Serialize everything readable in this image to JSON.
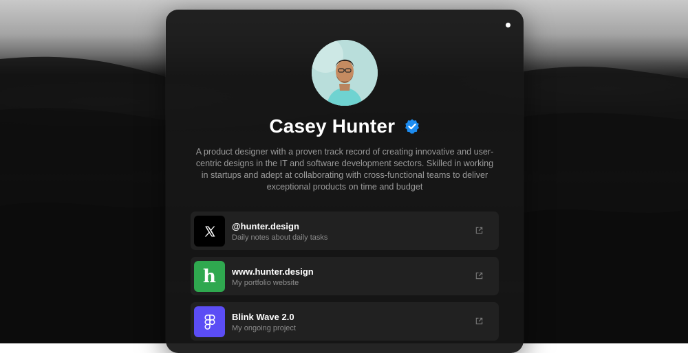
{
  "profile": {
    "name": "Casey Hunter",
    "verified": true,
    "bio": "A product designer with a proven track record of creating innovative and user-centric designs in the IT and software development sectors. Skilled in working in startups and adept at collaborating with cross-functional teams to deliver exceptional products on time and budget"
  },
  "links": [
    {
      "title": "@hunter.design",
      "subtitle": "Daily notes about daily tasks",
      "icon": "x-logo-icon",
      "icon_bg": "#000000"
    },
    {
      "title": "www.hunter.design",
      "subtitle": "My portfolio website",
      "icon": "h-letter-logo-icon",
      "icon_glyph": "h",
      "icon_bg": "#2fa84f"
    },
    {
      "title": "Blink Wave 2.0",
      "subtitle": "My ongoing project",
      "icon": "figma-logo-icon",
      "icon_bg": "#5b4df5"
    }
  ],
  "colors": {
    "card_bg": "#161616",
    "link_bg": "#212121",
    "verified_badge": "#1d8cf0",
    "status_dot": "#ffffff"
  }
}
